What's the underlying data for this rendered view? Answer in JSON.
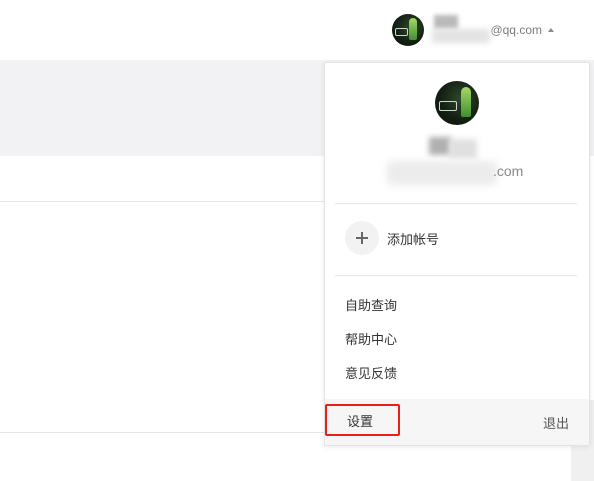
{
  "header": {
    "email_suffix": "@qq.com",
    "user_menu_icon": "caret-up-icon"
  },
  "dropdown": {
    "email_suffix": ".com",
    "add_account_label": "添加帐号",
    "add_icon": "plus-icon",
    "menu": [
      {
        "label": "自助查询"
      },
      {
        "label": "帮助中心"
      },
      {
        "label": "意见反馈"
      }
    ],
    "settings_label": "设置",
    "logout_label": "退出"
  },
  "colors": {
    "highlight_border": "#e8201a",
    "band": "#f2f2f4",
    "footer": "#f6f6f7"
  }
}
